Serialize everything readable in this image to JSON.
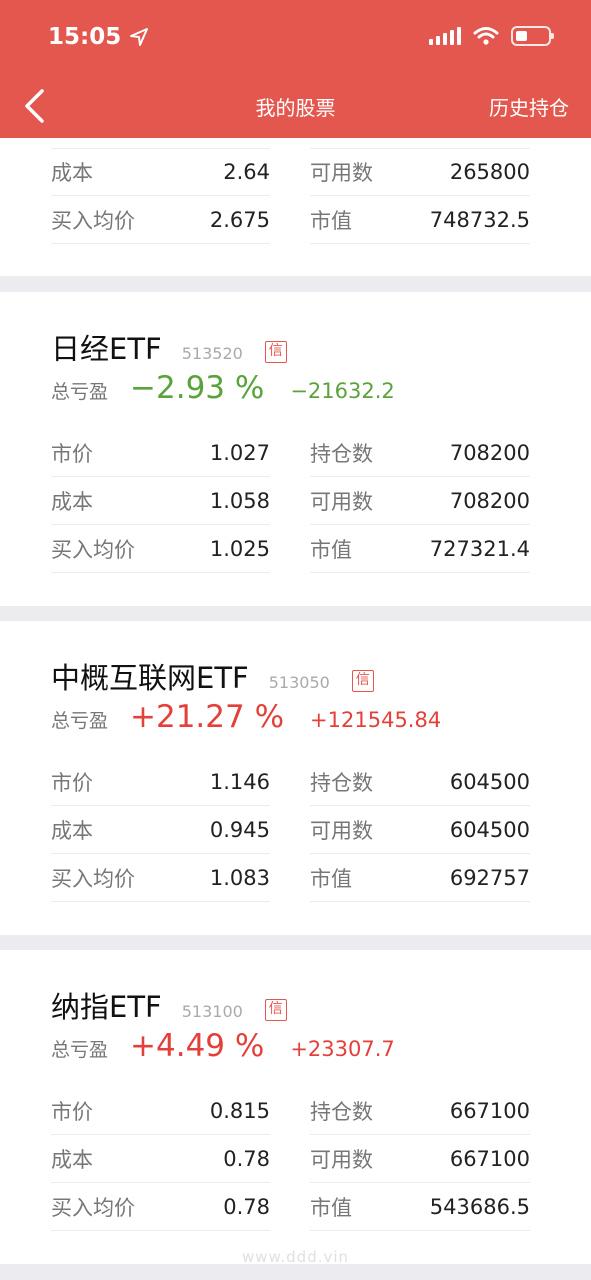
{
  "status_bar": {
    "time": "15:05"
  },
  "nav": {
    "title": "我的股票",
    "history_label": "历史持仓"
  },
  "top_card": {
    "rows_left": [
      {
        "label": "成本",
        "value": "2.64"
      },
      {
        "label": "买入均价",
        "value": "2.675"
      }
    ],
    "rows_right": [
      {
        "label": "可用数",
        "value": "265800"
      },
      {
        "label": "市值",
        "value": "748732.5"
      }
    ]
  },
  "stocks": [
    {
      "name": "日经ETF",
      "code": "513520",
      "badge": "信",
      "pnl_label": "总亏盈",
      "pnl_pct": "−2.93 %",
      "pnl_amount": "−21632.2",
      "trend": "negative",
      "rows_left": [
        {
          "label": "市价",
          "value": "1.027"
        },
        {
          "label": "成本",
          "value": "1.058"
        },
        {
          "label": "买入均价",
          "value": "1.025"
        }
      ],
      "rows_right": [
        {
          "label": "持仓数",
          "value": "708200"
        },
        {
          "label": "可用数",
          "value": "708200"
        },
        {
          "label": "市值",
          "value": "727321.4"
        }
      ]
    },
    {
      "name": "中概互联网ETF",
      "code": "513050",
      "badge": "信",
      "pnl_label": "总亏盈",
      "pnl_pct": "+21.27 %",
      "pnl_amount": "+121545.84",
      "trend": "positive",
      "rows_left": [
        {
          "label": "市价",
          "value": "1.146"
        },
        {
          "label": "成本",
          "value": "0.945"
        },
        {
          "label": "买入均价",
          "value": "1.083"
        }
      ],
      "rows_right": [
        {
          "label": "持仓数",
          "value": "604500"
        },
        {
          "label": "可用数",
          "value": "604500"
        },
        {
          "label": "市值",
          "value": "692757"
        }
      ]
    },
    {
      "name": "纳指ETF",
      "code": "513100",
      "badge": "信",
      "pnl_label": "总亏盈",
      "pnl_pct": "+4.49 %",
      "pnl_amount": "+23307.7",
      "trend": "positive",
      "rows_left": [
        {
          "label": "市价",
          "value": "0.815"
        },
        {
          "label": "成本",
          "value": "0.78"
        },
        {
          "label": "买入均价",
          "value": "0.78"
        }
      ],
      "rows_right": [
        {
          "label": "持仓数",
          "value": "667100"
        },
        {
          "label": "可用数",
          "value": "667100"
        },
        {
          "label": "市值",
          "value": "543686.5"
        }
      ]
    }
  ],
  "watermark": "www.ddd.vin",
  "colors": {
    "header": "#e4574f",
    "negative": "#5aa33b",
    "positive": "#e4403a"
  }
}
